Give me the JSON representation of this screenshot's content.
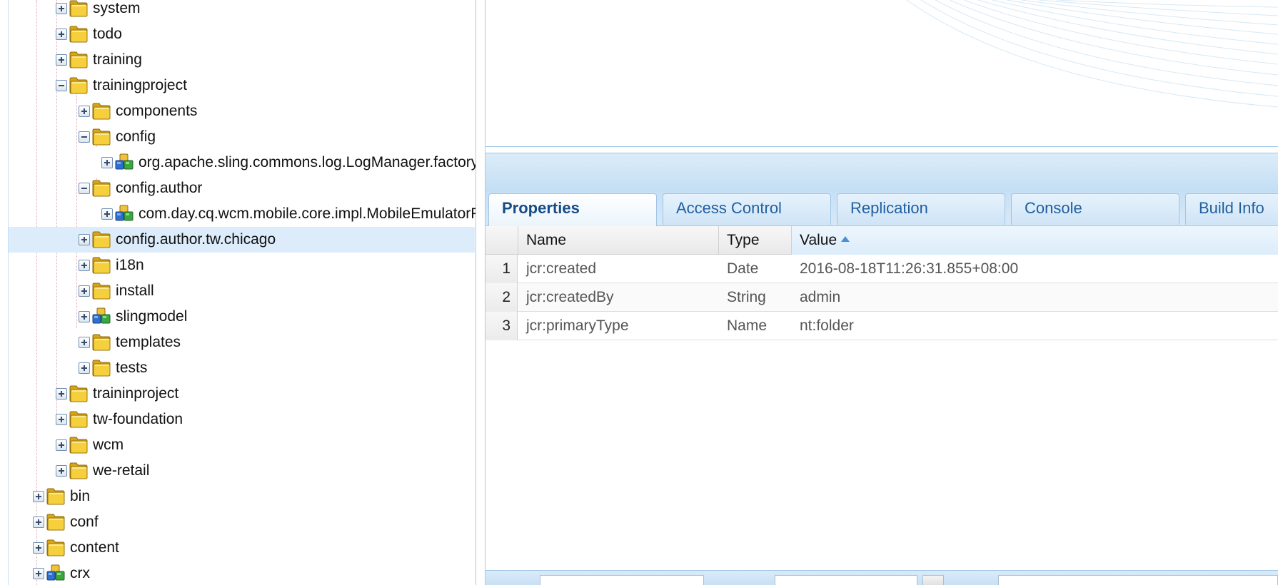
{
  "tree": {
    "nodes": [
      {
        "label": "system",
        "toggle": "plus",
        "icon": "folder-icon"
      },
      {
        "label": "todo",
        "toggle": "plus",
        "icon": "folder-icon"
      },
      {
        "label": "training",
        "toggle": "plus",
        "icon": "folder-icon"
      },
      {
        "label": "trainingproject",
        "toggle": "minus",
        "icon": "folder-icon"
      },
      {
        "label": "components",
        "toggle": "plus",
        "icon": "folder-icon"
      },
      {
        "label": "config",
        "toggle": "minus",
        "icon": "folder-icon"
      },
      {
        "label": "org.apache.sling.commons.log.LogManager.factory.config-trainingproject",
        "toggle": "plus",
        "icon": "node-icon"
      },
      {
        "label": "config.author",
        "toggle": "minus",
        "icon": "folder-icon"
      },
      {
        "label": "com.day.cq.wcm.mobile.core.impl.MobileEmulatorProvider-trainingproject",
        "toggle": "plus",
        "icon": "node-icon"
      },
      {
        "label": "config.author.tw.chicago",
        "toggle": "plus",
        "icon": "folder-icon",
        "selected": true
      },
      {
        "label": "i18n",
        "toggle": "plus",
        "icon": "folder-icon"
      },
      {
        "label": "install",
        "toggle": "plus",
        "icon": "folder-icon"
      },
      {
        "label": "slingmodel",
        "toggle": "plus",
        "icon": "node-icon"
      },
      {
        "label": "templates",
        "toggle": "plus",
        "icon": "folder-icon"
      },
      {
        "label": "tests",
        "toggle": "plus",
        "icon": "folder-icon"
      },
      {
        "label": "traininproject",
        "toggle": "plus",
        "icon": "folder-icon"
      },
      {
        "label": "tw-foundation",
        "toggle": "plus",
        "icon": "folder-icon"
      },
      {
        "label": "wcm",
        "toggle": "plus",
        "icon": "folder-icon"
      },
      {
        "label": "we-retail",
        "toggle": "plus",
        "icon": "folder-icon"
      },
      {
        "label": "bin",
        "toggle": "plus",
        "icon": "folder-icon"
      },
      {
        "label": "conf",
        "toggle": "plus",
        "icon": "folder-icon"
      },
      {
        "label": "content",
        "toggle": "plus",
        "icon": "folder-icon"
      },
      {
        "label": "crx",
        "toggle": "plus",
        "icon": "node-icon"
      }
    ]
  },
  "tabs": [
    {
      "label": "Properties",
      "active": true
    },
    {
      "label": "Access Control"
    },
    {
      "label": "Replication"
    },
    {
      "label": "Console"
    },
    {
      "label": "Build Info"
    }
  ],
  "grid": {
    "columns": [
      "Name",
      "Type",
      "Value"
    ],
    "sorted_column": "Value",
    "sort_direction": "ascending",
    "rows": [
      {
        "num": "1",
        "name": "jcr:created",
        "type": "Date",
        "value": "2016-08-18T11:26:31.855+08:00"
      },
      {
        "num": "2",
        "name": "jcr:createdBy",
        "type": "String",
        "value": "admin"
      },
      {
        "num": "3",
        "name": "jcr:primaryType",
        "type": "Name",
        "value": "nt:folder"
      }
    ]
  },
  "colors": {
    "panel_border": "#9fc5e6",
    "tab_text": "#1f5fa0",
    "selected_row": "#dcecfb",
    "folder_yellow": "#f2c22a"
  }
}
